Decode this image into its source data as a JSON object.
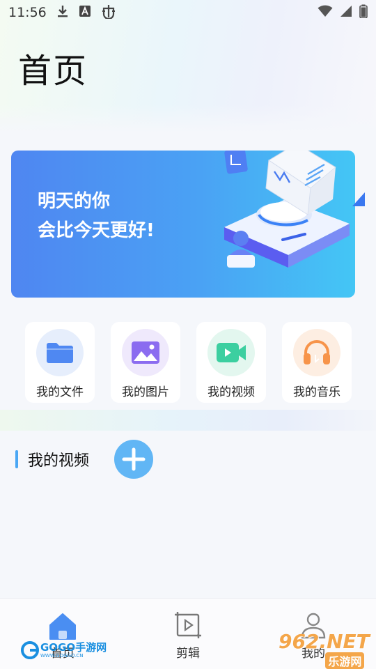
{
  "status_bar": {
    "time": "11:56",
    "icons": [
      "download-icon",
      "text-a-icon",
      "bug-icon"
    ],
    "right_icons": [
      "wifi-icon",
      "signal-icon",
      "battery-icon"
    ]
  },
  "header": {
    "title": "首页"
  },
  "banner": {
    "line1": "明天的你",
    "line2": "会比今天更好!",
    "gradient_start": "#4f86f1",
    "gradient_end": "#44c6f5"
  },
  "shortcuts": [
    {
      "label": "我的文件",
      "icon": "folder-icon",
      "color": "#4f88f2",
      "bg": "#e6eefc"
    },
    {
      "label": "我的图片",
      "icon": "image-icon",
      "color": "#8b6cf0",
      "bg": "#efe9fc"
    },
    {
      "label": "我的视频",
      "icon": "video-icon",
      "color": "#3ccfa0",
      "bg": "#e3f7ef"
    },
    {
      "label": "我的音乐",
      "icon": "headphones-icon",
      "color": "#f7944a",
      "bg": "#fdeee2"
    }
  ],
  "section": {
    "title": "我的视频",
    "accent": "#4aa7f4"
  },
  "bottom_nav": [
    {
      "label": "首页",
      "icon": "home-icon",
      "active": true
    },
    {
      "label": "剪辑",
      "icon": "clip-icon",
      "active": false
    },
    {
      "label": "我的",
      "icon": "user-icon",
      "active": false
    }
  ],
  "watermarks": {
    "left": "GOGO手游网",
    "left_url": "WWW.GOGGO.CN",
    "right": "962.NET",
    "right_sub": "乐游网"
  }
}
